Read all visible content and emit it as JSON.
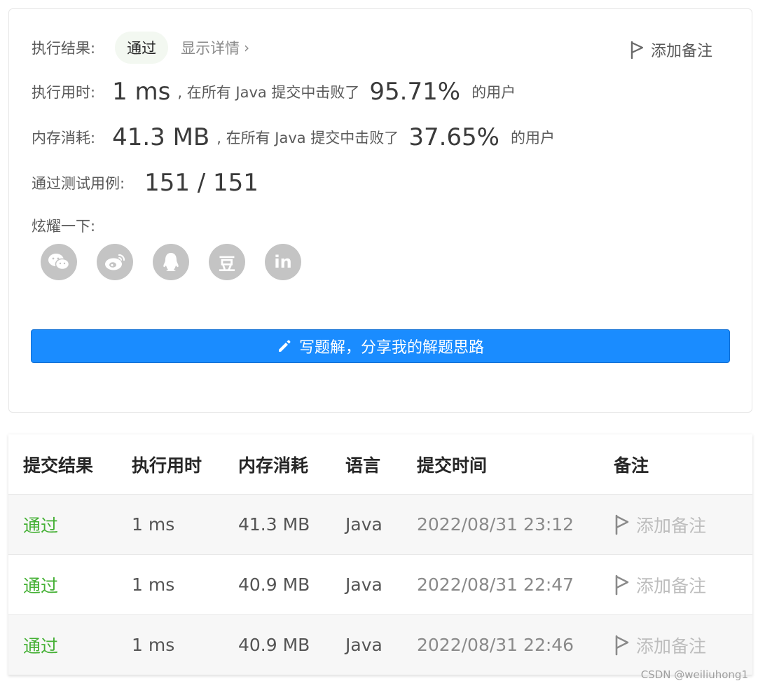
{
  "result": {
    "label": "执行结果:",
    "status": "通过",
    "detail_link": "显示详情",
    "add_note": "添加备注"
  },
  "runtime": {
    "label": "执行用时:",
    "value": "1 ms",
    "mid": ", 在所有 Java 提交中击败了",
    "percent": "95.71%",
    "suffix": "的用户"
  },
  "memory": {
    "label": "内存消耗:",
    "value": "41.3 MB",
    "mid": ", 在所有 Java 提交中击败了",
    "percent": "37.65%",
    "suffix": "的用户"
  },
  "tests": {
    "label": "通过测试用例:",
    "value": "151 / 151"
  },
  "share": {
    "label": "炫耀一下:",
    "icons": [
      "wechat-icon",
      "weibo-icon",
      "qq-icon",
      "douban-icon",
      "linkedin-icon"
    ],
    "douban_glyph": "豆",
    "linkedin_glyph": "in"
  },
  "write_button": "写题解，分享我的解题思路",
  "colors": {
    "accent": "#1a8cff",
    "success": "#45b035",
    "icon_gray": "#c4c4c4"
  },
  "table": {
    "headers": [
      "提交结果",
      "执行用时",
      "内存消耗",
      "语言",
      "提交时间",
      "备注"
    ],
    "rows": [
      {
        "status": "通过",
        "runtime": "1 ms",
        "memory": "41.3 MB",
        "language": "Java",
        "time": "2022/08/31 23:12",
        "note": "添加备注"
      },
      {
        "status": "通过",
        "runtime": "1 ms",
        "memory": "40.9 MB",
        "language": "Java",
        "time": "2022/08/31 22:47",
        "note": "添加备注"
      },
      {
        "status": "通过",
        "runtime": "1 ms",
        "memory": "40.9 MB",
        "language": "Java",
        "time": "2022/08/31 22:46",
        "note": "添加备注"
      }
    ]
  },
  "watermark": "CSDN @weiliuhong1"
}
